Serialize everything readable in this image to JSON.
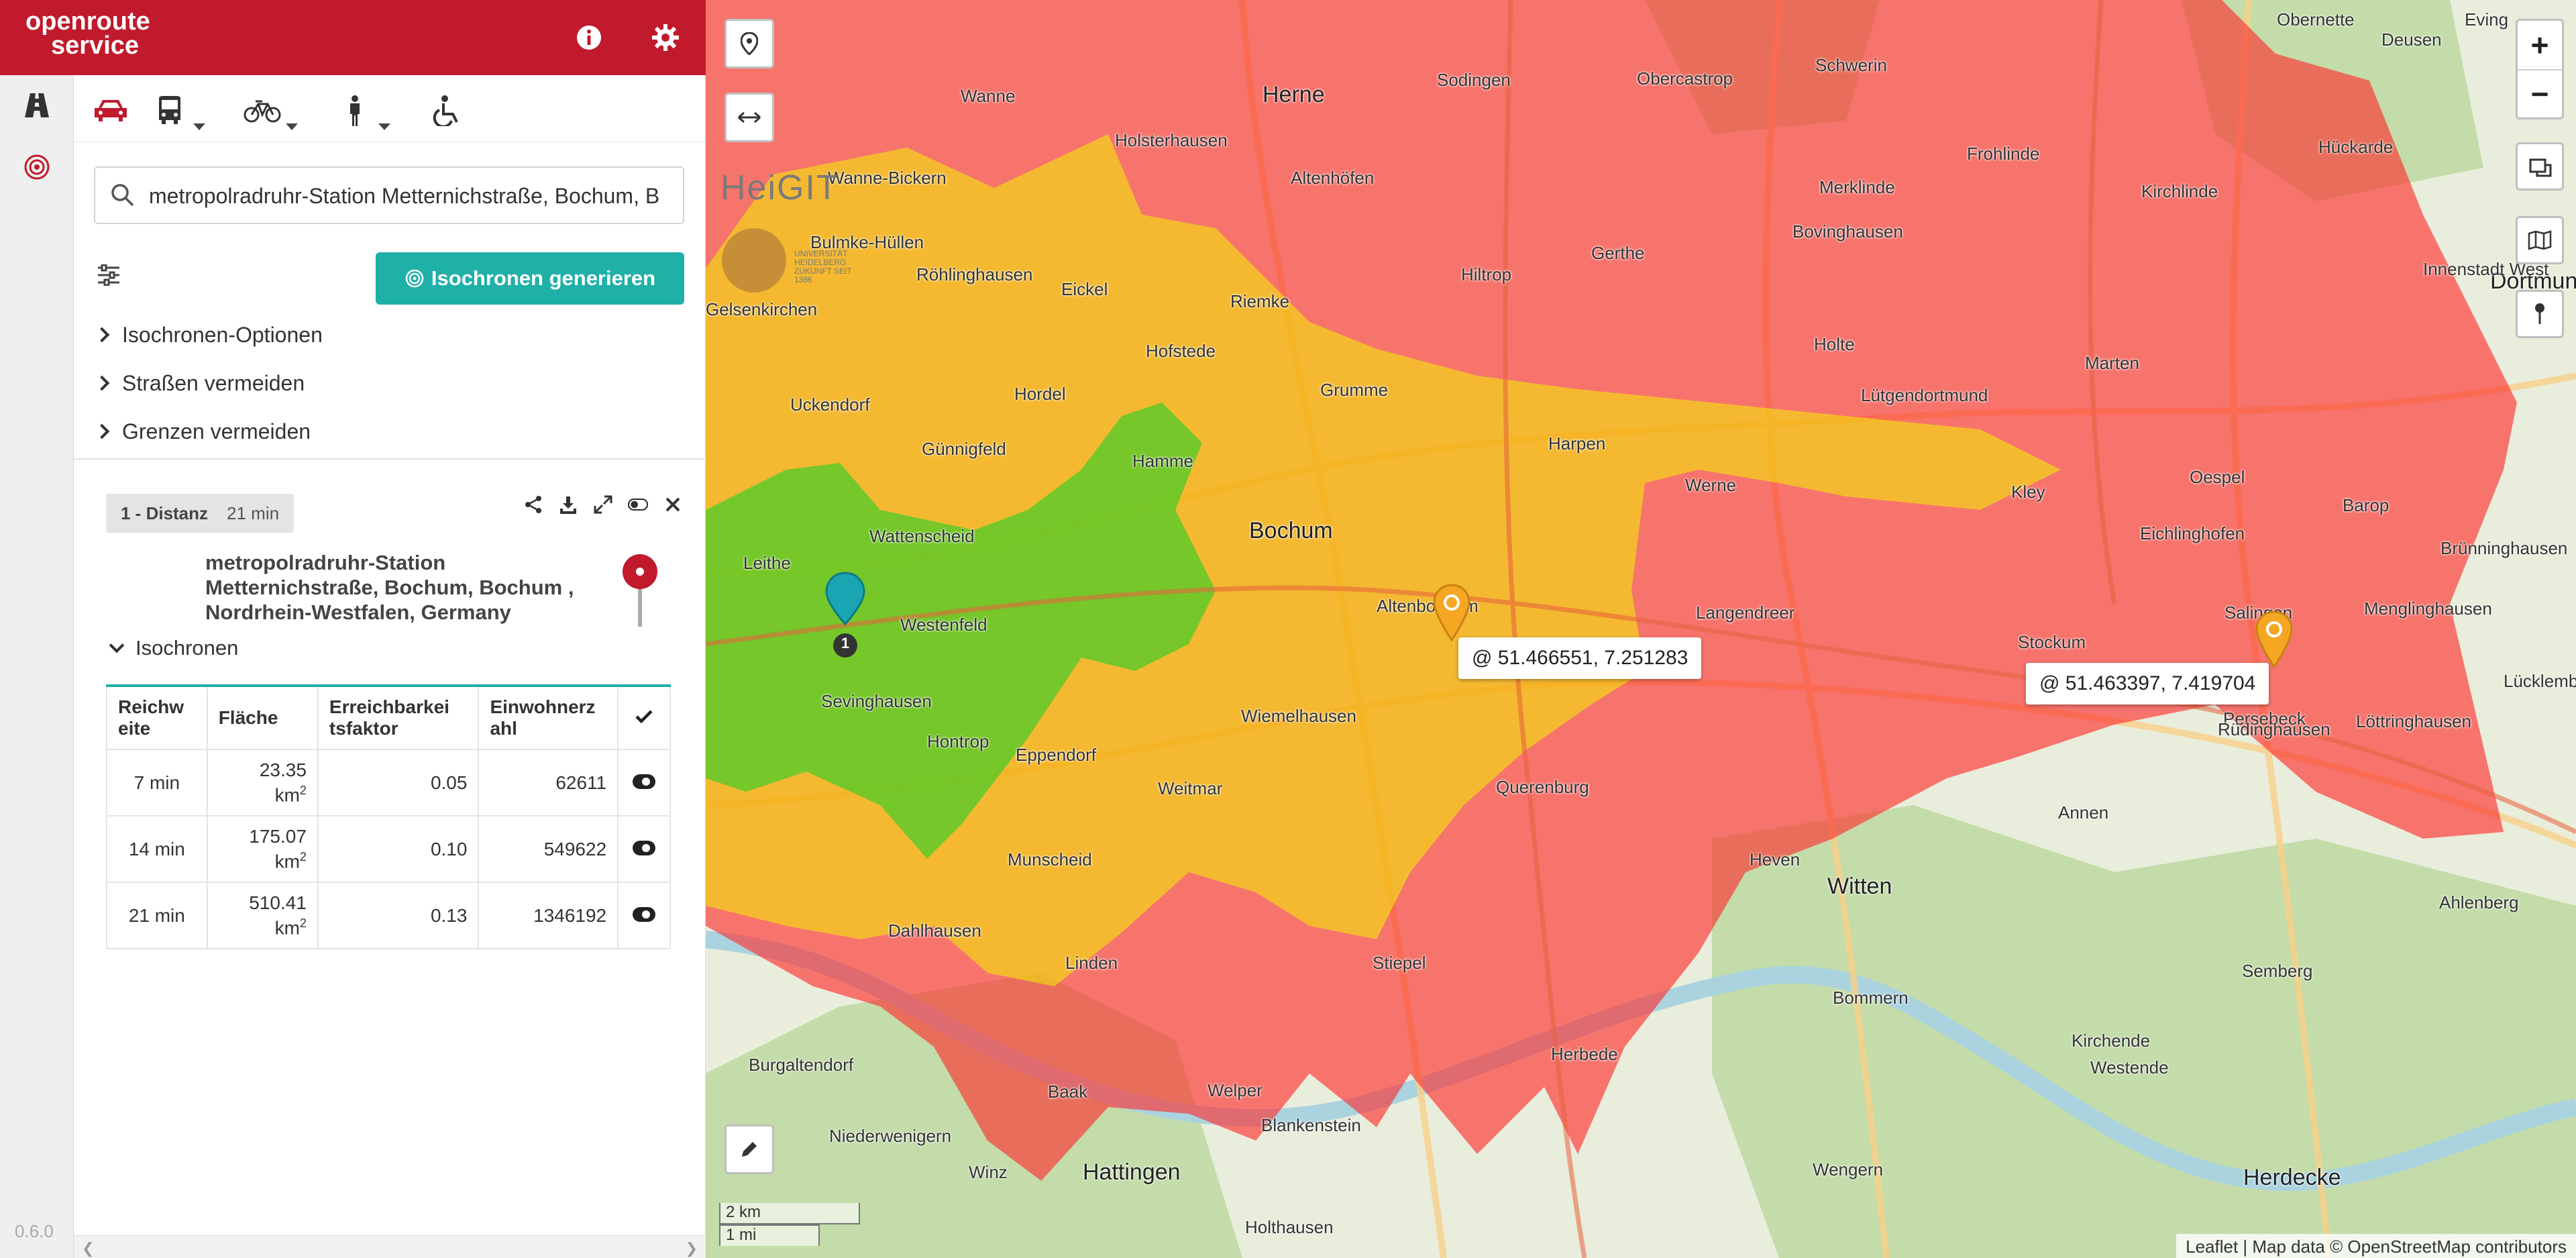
{
  "app": {
    "logo_line1": "openroute",
    "logo_line2": "service",
    "version": "0.6.0"
  },
  "colors": {
    "brand": "#c01a2c",
    "accent": "#1fb0a8",
    "iso_7": "#2ecc40",
    "iso_14": "#f0f000",
    "iso_21": "#ff3b3b"
  },
  "rail": {
    "items": [
      {
        "name": "directions",
        "icon": "road-icon"
      },
      {
        "name": "isochrones",
        "icon": "isochrone-target-icon"
      }
    ]
  },
  "header": {
    "icons": [
      "info-icon",
      "gear-icon"
    ]
  },
  "profiles": [
    {
      "name": "car",
      "icon": "car-icon",
      "active": true,
      "has_dropdown": false
    },
    {
      "name": "bus",
      "icon": "bus-icon",
      "active": false,
      "has_dropdown": true
    },
    {
      "name": "bike",
      "icon": "bicycle-icon",
      "active": false,
      "has_dropdown": true
    },
    {
      "name": "walk",
      "icon": "pedestrian-icon",
      "active": false,
      "has_dropdown": true
    },
    {
      "name": "wheelchair",
      "icon": "wheelchair-icon",
      "active": false,
      "has_dropdown": false
    }
  ],
  "search": {
    "value": "metropolradruhr-Station Metternichstraße, Bochum, B"
  },
  "actions": {
    "generate_label": "Isochronen generieren"
  },
  "options": {
    "isochrone_options": "Isochronen-Optionen",
    "avoid_streets": "Straßen vermeiden",
    "avoid_borders": "Grenzen vermeiden"
  },
  "result": {
    "tag_label": "1 - Distanz",
    "tag_time": "21 min",
    "place_name": "metropolradruhr-Station Metternichstraße, Bochum, Bochum , Nordrhein-Westfalen, Germany",
    "section_label": "Isochronen",
    "table": {
      "headers": [
        "Reichweite",
        "Fläche",
        "Erreichbarkeitsfaktor",
        "Einwohnerzahl"
      ],
      "headers_display": [
        "Reichw eite",
        "Fläche",
        "Erreichbarkei tsfaktor",
        "Einwohnerz ahl"
      ],
      "area_unit": "km",
      "rows": [
        {
          "range": "7 min",
          "area": "23.35",
          "factor": "0.05",
          "population": "62611"
        },
        {
          "range": "14 min",
          "area": "175.07",
          "factor": "0.10",
          "population": "549622"
        },
        {
          "range": "21 min",
          "area": "510.41",
          "factor": "0.13",
          "population": "1346192"
        }
      ]
    }
  },
  "map": {
    "heigit_label": "HeiGIT",
    "uni_label": "UNIVERSITÄT HEIDELBERG ZUKUNFT SEIT 1386",
    "places": [
      {
        "name": "Bochum",
        "big": true
      },
      {
        "name": "Herne",
        "big": true
      },
      {
        "name": "Dortmund",
        "big": true
      },
      {
        "name": "Witten",
        "big": true
      },
      {
        "name": "Hattingen",
        "big": true
      },
      {
        "name": "Herdecke",
        "big": true
      },
      {
        "name": "Wattenscheid",
        "big": false
      },
      {
        "name": "Westenfeld",
        "big": false
      },
      {
        "name": "Sevinghausen",
        "big": false
      },
      {
        "name": "Hontrop",
        "big": false
      },
      {
        "name": "Eppendorf",
        "big": false
      },
      {
        "name": "Weitmar",
        "big": false
      },
      {
        "name": "Munscheid",
        "big": false
      },
      {
        "name": "Dahlhausen",
        "big": false
      },
      {
        "name": "Linden",
        "big": false
      },
      {
        "name": "Wiemelhausen",
        "big": false
      },
      {
        "name": "Altenbochum",
        "big": false
      },
      {
        "name": "Querenburg",
        "big": false
      },
      {
        "name": "Stiepel",
        "big": false
      },
      {
        "name": "Langendreer",
        "big": false
      },
      {
        "name": "Werne",
        "big": false
      },
      {
        "name": "Harpen",
        "big": false
      },
      {
        "name": "Grumme",
        "big": false
      },
      {
        "name": "Hofstede",
        "big": false
      },
      {
        "name": "Riemke",
        "big": false
      },
      {
        "name": "Hamme",
        "big": false
      },
      {
        "name": "Hordel",
        "big": false
      },
      {
        "name": "Günnigfeld",
        "big": false
      },
      {
        "name": "Uckendorf",
        "big": false
      },
      {
        "name": "Leithe",
        "big": false
      },
      {
        "name": "Eickel",
        "big": false
      },
      {
        "name": "Röhlinghausen",
        "big": false
      },
      {
        "name": "Wanne",
        "big": false
      },
      {
        "name": "Wanne-Bickern",
        "big": false
      },
      {
        "name": "Holsterhausen",
        "big": false
      },
      {
        "name": "Altenhöfen",
        "big": false
      },
      {
        "name": "Hiltrop",
        "big": false
      },
      {
        "name": "Gerthe",
        "big": false
      },
      {
        "name": "Sodingen",
        "big": false
      },
      {
        "name": "Obercastrop",
        "big": false
      },
      {
        "name": "Schwerin",
        "big": false
      },
      {
        "name": "Frohlinde",
        "big": false
      },
      {
        "name": "Merklinde",
        "big": false
      },
      {
        "name": "Bovinghausen",
        "big": false
      },
      {
        "name": "Holte",
        "big": false
      },
      {
        "name": "Lütgendortmund",
        "big": false
      },
      {
        "name": "Marten",
        "big": false
      },
      {
        "name": "Kirchlinde",
        "big": false
      },
      {
        "name": "Oespel",
        "big": false
      },
      {
        "name": "Kley",
        "big": false
      },
      {
        "name": "Eichlinghofen",
        "big": false
      },
      {
        "name": "Barop",
        "big": false
      },
      {
        "name": "Salingen",
        "big": false
      },
      {
        "name": "Menglinghausen",
        "big": false
      },
      {
        "name": "Persebeck",
        "big": false
      },
      {
        "name": "Stockum",
        "big": false
      },
      {
        "name": "Rüdinghausen",
        "big": false
      },
      {
        "name": "Annen",
        "big": false
      },
      {
        "name": "Heven",
        "big": false
      },
      {
        "name": "Herbede",
        "big": false
      },
      {
        "name": "Bommern",
        "big": false
      },
      {
        "name": "Welper",
        "big": false
      },
      {
        "name": "Baak",
        "big": false
      },
      {
        "name": "Blankenstein",
        "big": false
      },
      {
        "name": "Burgaltendorf",
        "big": false
      },
      {
        "name": "Niederwenigern",
        "big": false
      },
      {
        "name": "Winz",
        "big": false
      },
      {
        "name": "Holthausen",
        "big": false
      },
      {
        "name": "Wengern",
        "big": false
      },
      {
        "name": "Kirchende",
        "big": false
      },
      {
        "name": "Westende",
        "big": false
      },
      {
        "name": "Semberg",
        "big": false
      },
      {
        "name": "Ahlenberg",
        "big": false
      },
      {
        "name": "Löttringhausen",
        "big": false
      },
      {
        "name": "Brünninghausen",
        "big": false
      },
      {
        "name": "Lücklemberg",
        "big": false
      },
      {
        "name": "Innenstadt West",
        "big": false
      },
      {
        "name": "Hückarde",
        "big": false
      },
      {
        "name": "Deusen",
        "big": false
      },
      {
        "name": "Obernette",
        "big": false
      },
      {
        "name": "Eving",
        "big": false
      },
      {
        "name": "Bulmke-Hüllen",
        "big": false
      },
      {
        "name": "Gelsenkirchen",
        "big": false
      }
    ],
    "popups": [
      {
        "text": "@ 51.466551, 7.251283"
      },
      {
        "text": "@ 51.463397, 7.419704"
      }
    ],
    "zoom_in": "+",
    "zoom_out": "−",
    "scale_km": "2 km",
    "scale_mi": "1 mi",
    "attribution": "Leaflet | Map data © OpenStreetMap contributors",
    "start_marker_label": "1"
  }
}
